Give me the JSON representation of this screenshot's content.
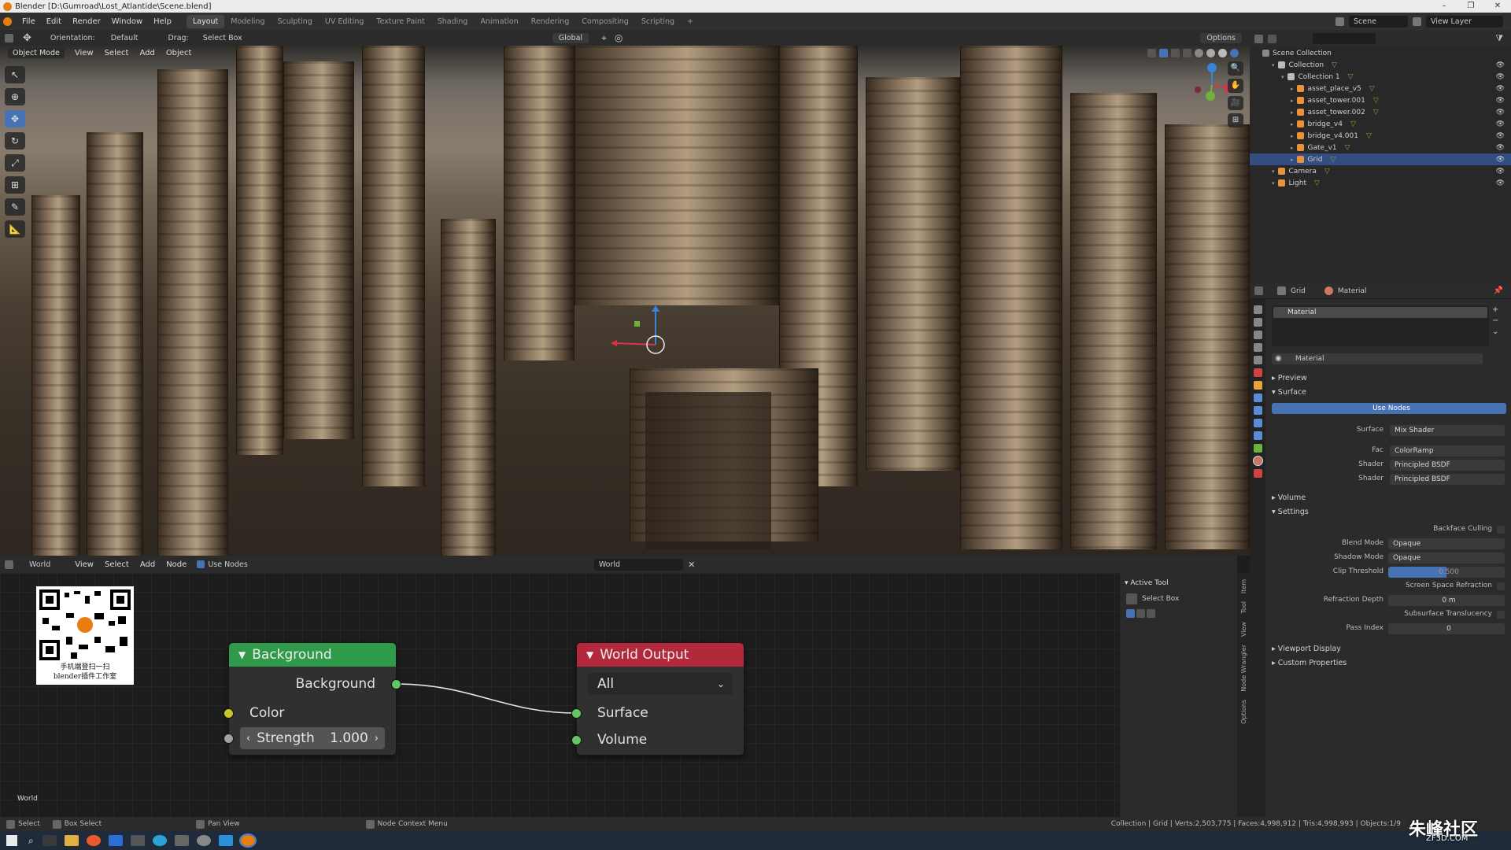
{
  "window": {
    "title": "Blender [D:\\Gumroad\\Lost_Atlantide\\Scene.blend]",
    "minimize": "–",
    "maximize": "❐",
    "close": "✕"
  },
  "menu": [
    "File",
    "Edit",
    "Render",
    "Window",
    "Help"
  ],
  "workspaces": [
    "Layout",
    "Modeling",
    "Sculpting",
    "UV Editing",
    "Texture Paint",
    "Shading",
    "Animation",
    "Rendering",
    "Compositing",
    "Scripting",
    "+"
  ],
  "scene": {
    "scene_name": "Scene",
    "view_layer": "View Layer"
  },
  "viewport_header": {
    "orientation_label": "Orientation:",
    "orientation_value": "Default",
    "drag_label": "Drag:",
    "drag_value": "Select Box",
    "transform": "Global",
    "options": "Options"
  },
  "viewport_menu": {
    "mode": "Object Mode",
    "items": [
      "View",
      "Select",
      "Add",
      "Object"
    ]
  },
  "node_header": {
    "editor_type": "World",
    "items": [
      "View",
      "Select",
      "Add",
      "Node"
    ],
    "use_nodes": "Use Nodes",
    "world_name": "World"
  },
  "node_editor": {
    "world_label": "World"
  },
  "qr": {
    "caption_line1": "手机端登扫一扫",
    "caption_line2": "blender插件工作室"
  },
  "background_node": {
    "title": "Background",
    "output": "Background",
    "color": "Color",
    "strength_label": "Strength",
    "strength_value": "1.000",
    "header_color": "#2e9a4a"
  },
  "world_output_node": {
    "title": "World Output",
    "target": "All",
    "surface": "Surface",
    "volume": "Volume",
    "header_color": "#b3293b"
  },
  "npanel": {
    "title": "Active Tool",
    "tool": "Select Box",
    "tabs": [
      "Item",
      "Tool",
      "View",
      "Node Wrangler",
      "Options"
    ]
  },
  "outliner": {
    "root": "Scene Collection",
    "items": [
      {
        "label": "Collection",
        "level": 1
      },
      {
        "label": "Collection 1",
        "level": 2
      },
      {
        "label": "asset_place_v5",
        "level": 3
      },
      {
        "label": "asset_tower.001",
        "level": 3
      },
      {
        "label": "asset_tower.002",
        "level": 3
      },
      {
        "label": "bridge_v4",
        "level": 3
      },
      {
        "label": "bridge_v4.001",
        "level": 3
      },
      {
        "label": "Gate_v1",
        "level": 3
      },
      {
        "label": "Grid",
        "level": 3,
        "selected": true
      },
      {
        "label": "Camera",
        "level": 1
      },
      {
        "label": "Light",
        "level": 1
      }
    ]
  },
  "properties": {
    "object": "Grid",
    "context": "Material",
    "slot": "Material",
    "material_name": "Material",
    "sections": {
      "preview": "Preview",
      "surface": "Surface",
      "volume": "Volume",
      "settings": "Settings",
      "viewport_display": "Viewport Display",
      "custom_properties": "Custom Properties"
    },
    "use_nodes": "Use Nodes",
    "surface_rows": [
      {
        "label": "Surface",
        "value": "Mix Shader"
      },
      {
        "label": "Fac",
        "value": "ColorRamp"
      },
      {
        "label": "Shader",
        "value": "Principled BSDF"
      },
      {
        "label": "Shader",
        "value": "Principled BSDF"
      }
    ],
    "settings_rows": [
      {
        "label": "Backface Culling",
        "value": ""
      },
      {
        "label": "Blend Mode",
        "value": "Opaque"
      },
      {
        "label": "Shadow Mode",
        "value": "Opaque"
      },
      {
        "label": "Clip Threshold",
        "value": "0.500"
      },
      {
        "label": "Screen Space Refraction",
        "value": ""
      },
      {
        "label": "Refraction Depth",
        "value": "0 m"
      },
      {
        "label": "Subsurface Translucency",
        "value": ""
      },
      {
        "label": "Pass Index",
        "value": "0"
      }
    ]
  },
  "statusbar": {
    "select": "Select",
    "box_select": "Box Select",
    "pan_view": "Pan View",
    "context_menu": "Node Context Menu",
    "stats": "Collection | Grid | Verts:2,503,775 | Faces:4,998,912 | Tris:4,998,993 | Objects:1/9"
  },
  "watermark": {
    "brand": "朱峰社区",
    "url": "ZF3D.COM"
  }
}
